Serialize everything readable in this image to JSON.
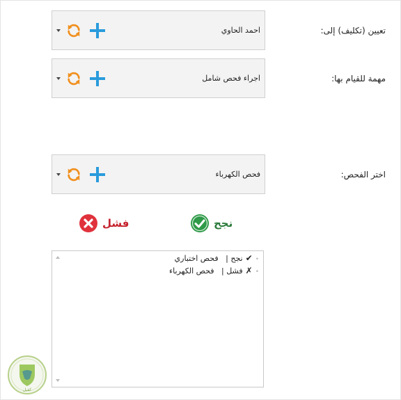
{
  "form": {
    "assign_label": "تعيين (تكليف) إلى:",
    "assign_value": "احمد الحاوي",
    "task_label": "مهمة للقيام بها:",
    "task_value": "اجراء فحص شامل",
    "check_label": "اختر الفحص:",
    "check_value": "فحص الكهرباء"
  },
  "results": {
    "pass_label": "نجح",
    "fail_label": "فشل"
  },
  "log": {
    "items": [
      {
        "mark": "✔",
        "status": "نجح |",
        "check": "فحص اختباري"
      },
      {
        "mark": "✗",
        "status": "فشل |",
        "check": "فحص الكهرباء"
      }
    ]
  },
  "logo": {
    "text": "كفيل"
  },
  "colors": {
    "plus": "#2a9bdc",
    "refresh": "#f0901e",
    "pass": "#2b7a3a",
    "fail": "#e0323c"
  },
  "icons": [
    "chevron-down-icon",
    "refresh-icon",
    "plus-icon",
    "check-circle-icon",
    "x-circle-icon"
  ]
}
